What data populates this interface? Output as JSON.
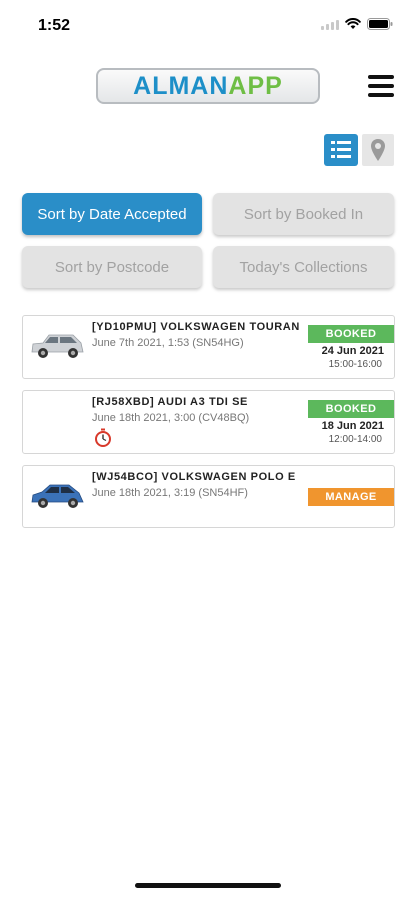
{
  "status_bar": {
    "time": "1:52"
  },
  "header": {
    "logo_part1": "ALMAN",
    "logo_part2": "APP"
  },
  "sort_buttons": [
    {
      "label": "Sort by Date Accepted",
      "active": true
    },
    {
      "label": "Sort by Booked In",
      "active": false
    },
    {
      "label": "Sort by Postcode",
      "active": false
    },
    {
      "label": "Today's Collections",
      "active": false
    }
  ],
  "jobs": [
    {
      "title": "[YD10PMU] VOLKSWAGEN TOURAN",
      "subtitle": "June 7th 2021, 1:53 (SN54HG)",
      "status": "BOOKED",
      "booked_date": "24 Jun 2021",
      "booked_time": "15:00-16:00",
      "car_color": "silver"
    },
    {
      "title": "[RJ58XBD] AUDI A3 TDI SE",
      "subtitle": "June 18th 2021, 3:00 (CV48BQ)",
      "status": "BOOKED",
      "booked_date": "18 Jun 2021",
      "booked_time": "12:00-14:00",
      "icon": "stopwatch-icon"
    },
    {
      "title": "[WJ54BCO] VOLKSWAGEN POLO E",
      "subtitle": "June 18th 2021, 3:19 (SN54HF)",
      "status": "MANAGE",
      "car_color": "blue"
    }
  ],
  "colors": {
    "primary": "#2a8ec8",
    "booked": "#5cb85c",
    "manage": "#f0952e",
    "logo_blue": "#1d8fc8",
    "logo_green": "#6fbe45"
  },
  "icons": [
    "signal-icon",
    "wifi-icon",
    "battery-icon",
    "menu-icon",
    "list-view-icon",
    "map-pin-icon",
    "stopwatch-icon",
    "car-icon"
  ]
}
